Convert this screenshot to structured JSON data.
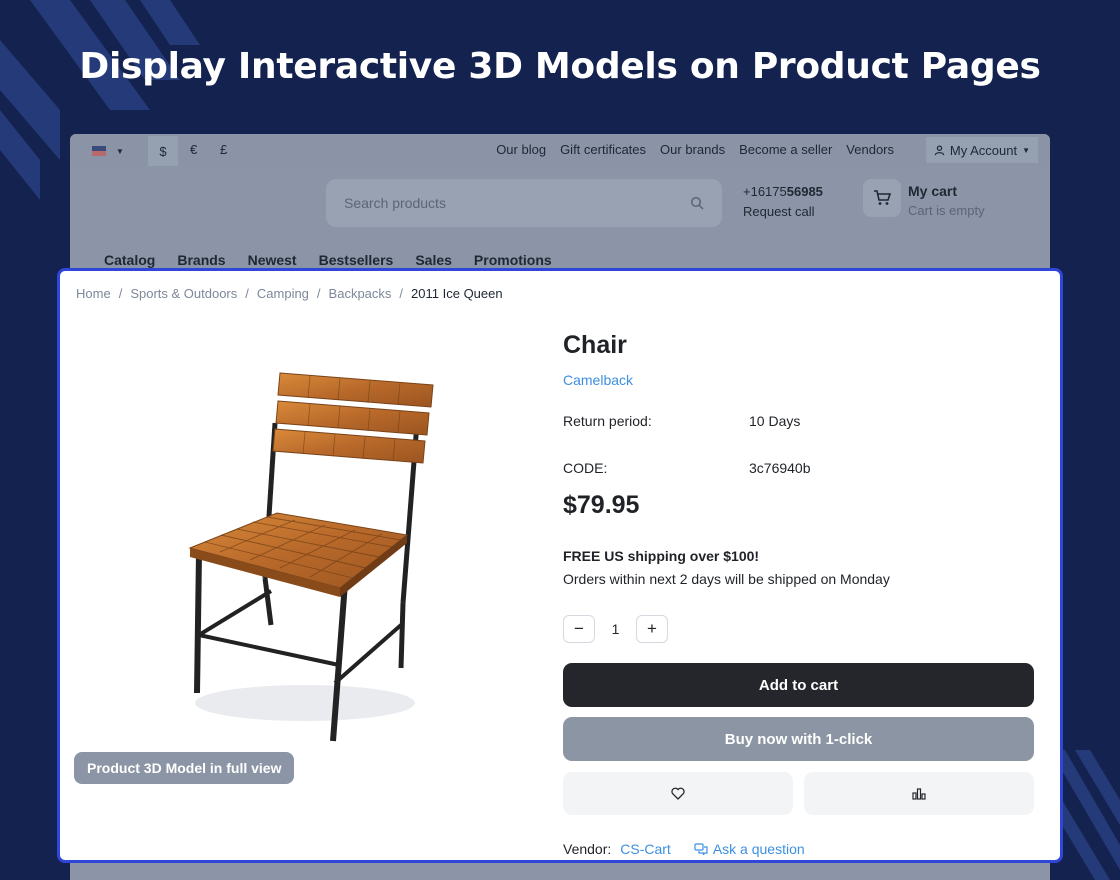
{
  "headline": "Display Interactive 3D Models on Product Pages",
  "topbar": {
    "currencies": [
      "$",
      "€",
      "£"
    ],
    "links": [
      "Our blog",
      "Gift certificates",
      "Our brands",
      "Become a seller",
      "Vendors"
    ],
    "account": "My Account"
  },
  "header": {
    "search_placeholder": "Search products",
    "phone_prefix": "+16175",
    "phone_bold": "56985",
    "request_call": "Request call",
    "cart_title": "My cart",
    "cart_status": "Cart is empty"
  },
  "nav": [
    "Catalog",
    "Brands",
    "Newest",
    "Bestsellers",
    "Sales",
    "Promotions"
  ],
  "breadcrumb": [
    "Home",
    "Sports & Outdoors",
    "Camping",
    "Backpacks",
    "2011 Ice Queen"
  ],
  "product": {
    "title": "Chair",
    "brand": "Camelback",
    "return_label": "Return period:",
    "return_value": "10 Days",
    "code_label": "CODE:",
    "code_value": "3c76940b",
    "price": "$79.95",
    "shipping_title": "FREE US shipping over $100!",
    "shipping_text": "Orders within next 2 days will be shipped on Monday",
    "quantity": "1",
    "add_to_cart": "Add to cart",
    "buy_now": "Buy now with 1-click",
    "view_3d": "Product 3D Model in full view",
    "vendor_label": "Vendor:",
    "vendor_name": "CS-Cart",
    "ask_question": "Ask a question"
  },
  "colors": {
    "background": "#14224f",
    "highlight_border": "#2f46d9",
    "link": "#3d8fe0",
    "primary_button": "#24262b"
  }
}
